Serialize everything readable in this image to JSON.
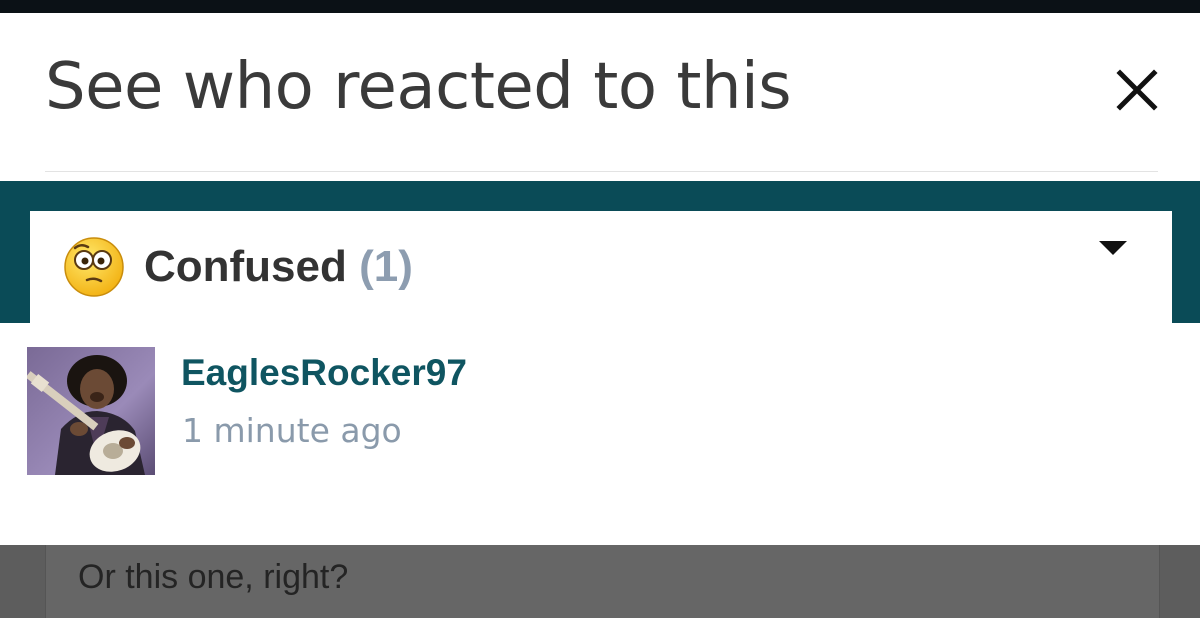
{
  "modal": {
    "title": "See who reacted to this",
    "close_icon": "close-icon"
  },
  "reaction_tab": {
    "emoji_icon": "confused-face-icon",
    "label": "Confused",
    "count": "(1)",
    "dropdown_icon": "caret-down-icon"
  },
  "reactors": [
    {
      "username": "EaglesRocker97",
      "time": "1 minute ago",
      "avatar_icon": "user-avatar"
    }
  ],
  "background_post": {
    "text": "Or this one, right?"
  },
  "colors": {
    "accent_teal": "#0a4b57",
    "username": "#0f5561",
    "muted": "#8a9aab",
    "backdrop": "#5d5d5d"
  }
}
